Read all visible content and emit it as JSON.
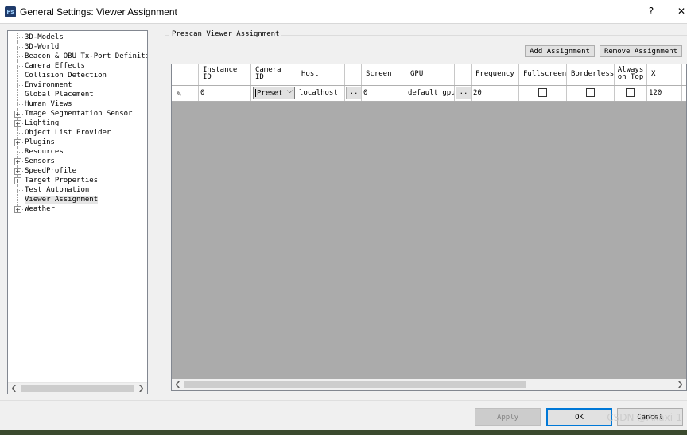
{
  "window": {
    "title": "General Settings: Viewer Assignment",
    "app_icon_text": "Ps",
    "help_label": "?",
    "close_label": "✕"
  },
  "tree": {
    "items": [
      {
        "label": "3D-Models",
        "expandable": false
      },
      {
        "label": "3D-World",
        "expandable": false
      },
      {
        "label": "Beacon & OBU Tx-Port Definitio",
        "expandable": false
      },
      {
        "label": "Camera Effects",
        "expandable": false
      },
      {
        "label": "Collision Detection",
        "expandable": false
      },
      {
        "label": "Environment",
        "expandable": false
      },
      {
        "label": "Global Placement",
        "expandable": false
      },
      {
        "label": "Human Views",
        "expandable": false
      },
      {
        "label": "Image Segmentation Sensor",
        "expandable": true
      },
      {
        "label": "Lighting",
        "expandable": true
      },
      {
        "label": "Object List Provider",
        "expandable": false
      },
      {
        "label": "Plugins",
        "expandable": true
      },
      {
        "label": "Resources",
        "expandable": false
      },
      {
        "label": "Sensors",
        "expandable": true
      },
      {
        "label": "SpeedProfile",
        "expandable": true
      },
      {
        "label": "Target Properties",
        "expandable": true
      },
      {
        "label": "Test Automation",
        "expandable": false
      },
      {
        "label": "Viewer Assignment",
        "expandable": false,
        "selected": true
      },
      {
        "label": "Weather",
        "expandable": true
      }
    ]
  },
  "panel": {
    "group_title": "Prescan Viewer Assignment",
    "add_label": "Add Assignment",
    "remove_label": "Remove Assignment"
  },
  "grid": {
    "headers": {
      "instance_1": "Instance",
      "instance_2": "ID",
      "camera_1": "Camera",
      "camera_2": "ID",
      "host": "Host",
      "screen": "Screen",
      "gpu": "GPU",
      "frequency": "Frequency",
      "fullscreen": "Fullscreen",
      "borderless": "Borderless",
      "always_1": "Always",
      "always_2": "on Top",
      "x": "X"
    },
    "row": {
      "instance_id": "0",
      "camera_id": "Preset",
      "host": "localhost",
      "host_browse": "..",
      "screen": "0",
      "gpu": "default gpu",
      "gpu_browse": "..",
      "frequency": "20",
      "fullscreen": false,
      "borderless": false,
      "always_on_top": false,
      "x": "120"
    }
  },
  "footer": {
    "apply_label": "Apply",
    "ok_label": "OK",
    "cancel_label": "Cancel",
    "watermark": "CSDN @Akaxi-1"
  }
}
